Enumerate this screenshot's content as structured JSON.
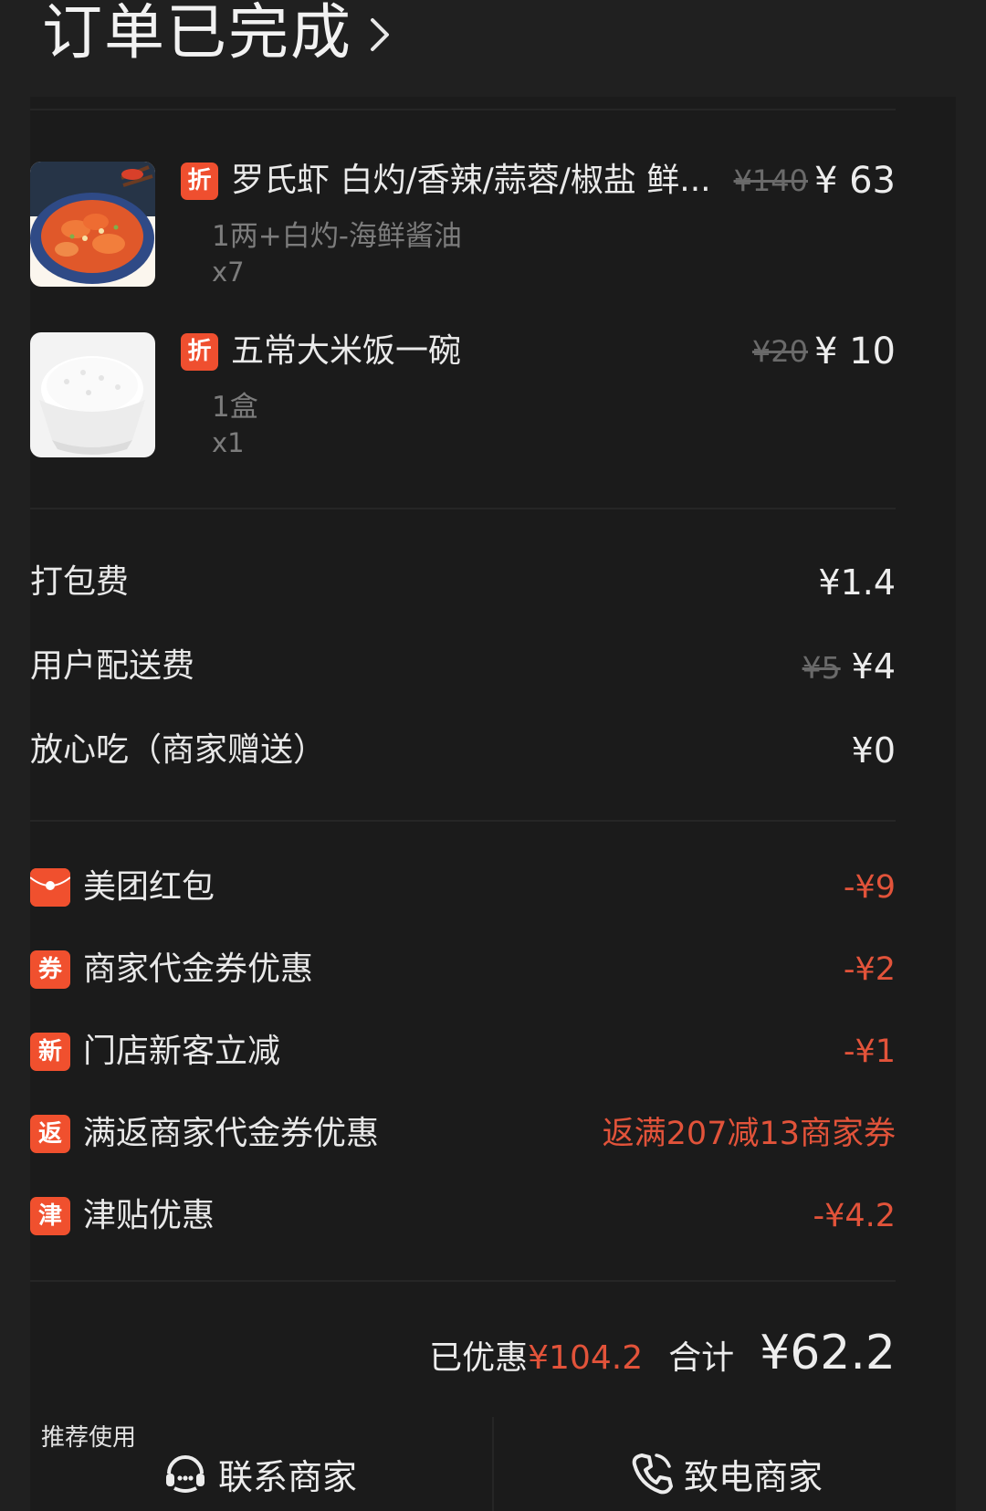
{
  "header": {
    "title": "订单已完成"
  },
  "items": [
    {
      "tag": "折",
      "name": "罗氏虾 白灼/香辣/蒜蓉/椒盐 鲜...",
      "spec": "1两+白灼-海鲜酱油",
      "qty": "x7",
      "original_price": "¥140",
      "price": "¥ 63"
    },
    {
      "tag": "折",
      "name": "五常大米饭一碗",
      "spec": "1盒",
      "qty": "x1",
      "original_price": "¥20",
      "price": "¥ 10"
    }
  ],
  "fees": [
    {
      "label": "打包费",
      "original": "",
      "value": "¥1.4"
    },
    {
      "label": "用户配送费",
      "original": "¥5",
      "value": "¥4"
    },
    {
      "label": "放心吃（商家赠送）",
      "original": "",
      "value": "¥0"
    }
  ],
  "discounts": [
    {
      "icon": "",
      "label": "美团红包",
      "value": "-¥9"
    },
    {
      "icon": "券",
      "label": "商家代金券优惠",
      "value": "-¥2"
    },
    {
      "icon": "新",
      "label": "门店新客立减",
      "value": "-¥1"
    },
    {
      "icon": "返",
      "label": "满返商家代金券优惠",
      "value": "返满207减13商家券"
    },
    {
      "icon": "津",
      "label": "津贴优惠",
      "value": "-¥4.2"
    }
  ],
  "summary": {
    "saved_label": "已优惠",
    "saved_value": "¥104.2",
    "total_label": "合计",
    "total_value": "¥62.2"
  },
  "bottom_bar": {
    "hint": "推荐使用",
    "contact_label": "联系商家",
    "call_label": "致电商家"
  },
  "colors": {
    "accent": "#ef4f2f",
    "discount_text": "#e2533a",
    "background": "#1b1b1b"
  }
}
